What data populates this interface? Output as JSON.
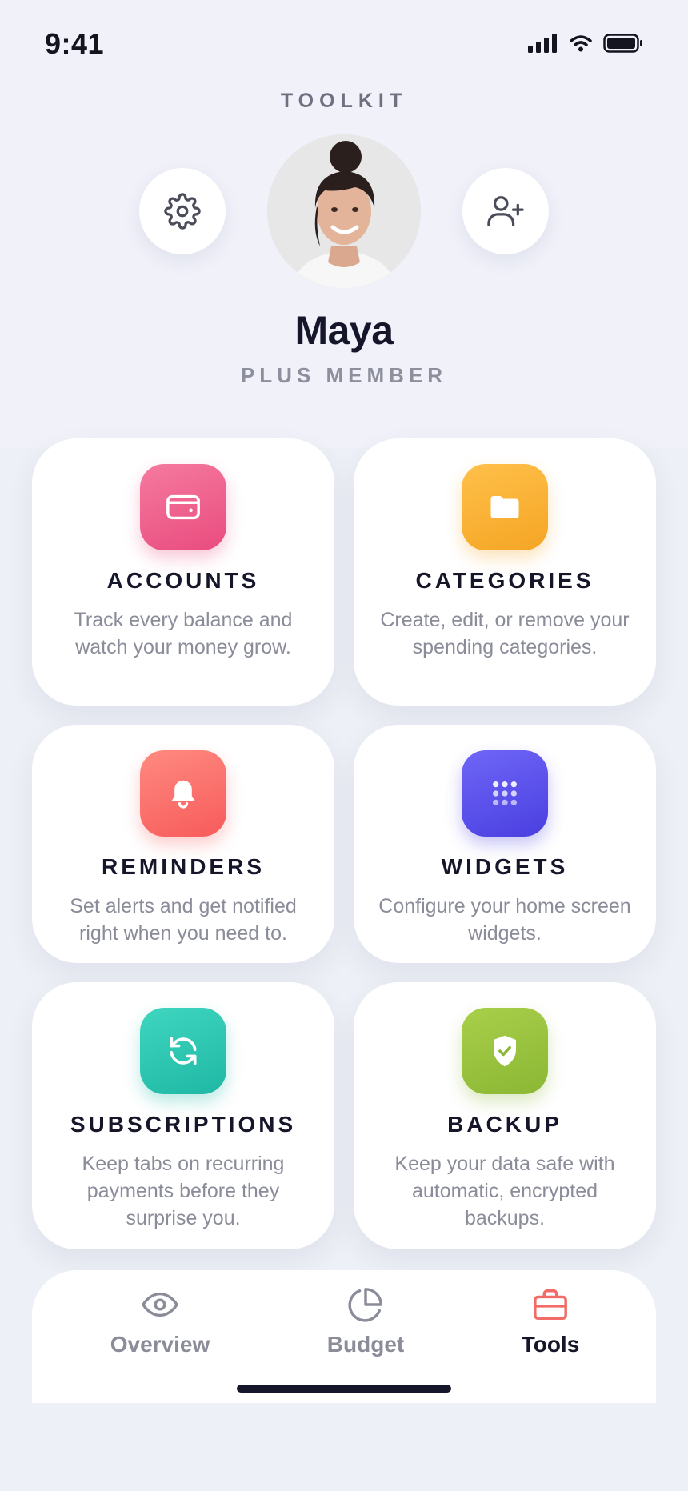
{
  "status_bar": {
    "time": "9:41"
  },
  "header": {
    "title": "TOOLKIT"
  },
  "profile": {
    "name": "Maya",
    "membership": "PLUS MEMBER"
  },
  "cards": [
    {
      "title": "ACCOUNTS",
      "description": "Track every balance and watch your money grow.",
      "icon": "wallet-icon",
      "color": "#ef5f8d"
    },
    {
      "title": "CATEGORIES",
      "description": "Create, edit, or remove your spending categories.",
      "icon": "folder-icon",
      "color": "#f9ae2f"
    },
    {
      "title": "REMINDERS",
      "description": "Set alerts and get notified right when you need to.",
      "icon": "bell-icon",
      "color": "#fb6d6d"
    },
    {
      "title": "WIDGETS",
      "description": "Configure your home screen widgets.",
      "icon": "grid-icon",
      "color": "#5b4ff0"
    },
    {
      "title": "SUBSCRIPTIONS",
      "description": "Keep tabs on recurring payments before they surprise you.",
      "icon": "refresh-icon",
      "color": "#26c4b0"
    },
    {
      "title": "BACKUP",
      "description": "Keep your data safe with automatic, encrypted backups.",
      "icon": "shield-check-icon",
      "color": "#96c13c"
    }
  ],
  "nav": {
    "items": [
      {
        "label": "Overview",
        "icon": "eye-icon",
        "active": false
      },
      {
        "label": "Budget",
        "icon": "pie-chart-icon",
        "active": false
      },
      {
        "label": "Tools",
        "icon": "briefcase-icon",
        "active": true
      }
    ],
    "active_color": "#16162a",
    "inactive_color": "#8a8c99",
    "accent_icon_color": "#f26b66"
  }
}
